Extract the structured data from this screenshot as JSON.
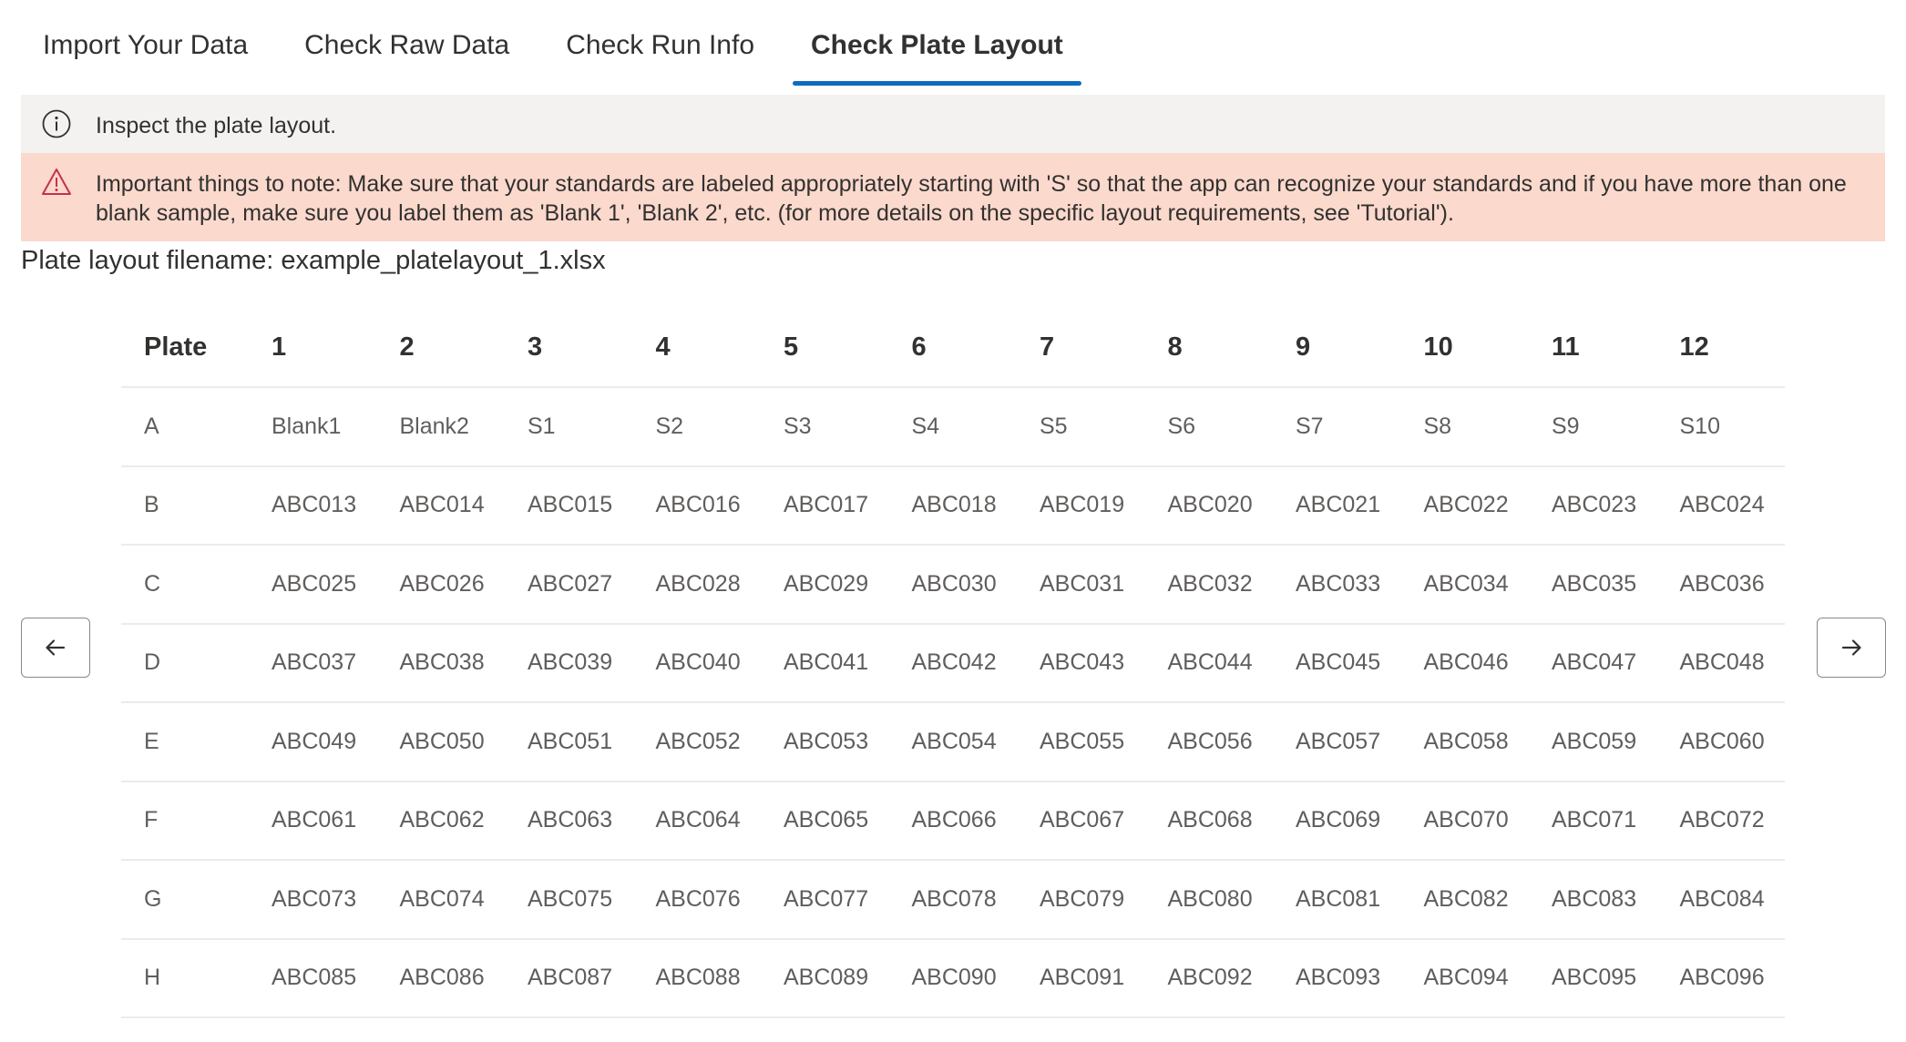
{
  "tabs": [
    {
      "label": "Import Your Data",
      "active": false
    },
    {
      "label": "Check Raw Data",
      "active": false
    },
    {
      "label": "Check Run Info",
      "active": false
    },
    {
      "label": "Check Plate Layout",
      "active": true
    }
  ],
  "info_message": {
    "icon": "info-icon",
    "text": "Inspect the plate layout."
  },
  "warning_message": {
    "icon": "warning-icon",
    "color": "#fbd9cd",
    "text": "Important things to note: Make sure that your standards are labeled appropriately starting with 'S' so that the app can recognize your standards and if you have more than one blank sample, make sure you label them as 'Blank 1', 'Blank 2', etc. (for more details on the specific layout requirements, see 'Tutorial')."
  },
  "filename_label": "Plate layout filename: example_platelayout_1.xlsx",
  "navigation": {
    "prev_icon": "arrow-left-icon",
    "next_icon": "arrow-right-icon"
  },
  "table": {
    "headers": [
      "Plate",
      "1",
      "2",
      "3",
      "4",
      "5",
      "6",
      "7",
      "8",
      "9",
      "10",
      "11",
      "12"
    ],
    "rows": [
      [
        "A",
        "Blank1",
        "Blank2",
        "S1",
        "S2",
        "S3",
        "S4",
        "S5",
        "S6",
        "S7",
        "S8",
        "S9",
        "S10"
      ],
      [
        "B",
        "ABC013",
        "ABC014",
        "ABC015",
        "ABC016",
        "ABC017",
        "ABC018",
        "ABC019",
        "ABC020",
        "ABC021",
        "ABC022",
        "ABC023",
        "ABC024"
      ],
      [
        "C",
        "ABC025",
        "ABC026",
        "ABC027",
        "ABC028",
        "ABC029",
        "ABC030",
        "ABC031",
        "ABC032",
        "ABC033",
        "ABC034",
        "ABC035",
        "ABC036"
      ],
      [
        "D",
        "ABC037",
        "ABC038",
        "ABC039",
        "ABC040",
        "ABC041",
        "ABC042",
        "ABC043",
        "ABC044",
        "ABC045",
        "ABC046",
        "ABC047",
        "ABC048"
      ],
      [
        "E",
        "ABC049",
        "ABC050",
        "ABC051",
        "ABC052",
        "ABC053",
        "ABC054",
        "ABC055",
        "ABC056",
        "ABC057",
        "ABC058",
        "ABC059",
        "ABC060"
      ],
      [
        "F",
        "ABC061",
        "ABC062",
        "ABC063",
        "ABC064",
        "ABC065",
        "ABC066",
        "ABC067",
        "ABC068",
        "ABC069",
        "ABC070",
        "ABC071",
        "ABC072"
      ],
      [
        "G",
        "ABC073",
        "ABC074",
        "ABC075",
        "ABC076",
        "ABC077",
        "ABC078",
        "ABC079",
        "ABC080",
        "ABC081",
        "ABC082",
        "ABC083",
        "ABC084"
      ],
      [
        "H",
        "ABC085",
        "ABC086",
        "ABC087",
        "ABC088",
        "ABC089",
        "ABC090",
        "ABC091",
        "ABC092",
        "ABC093",
        "ABC094",
        "ABC095",
        "ABC096"
      ]
    ]
  }
}
